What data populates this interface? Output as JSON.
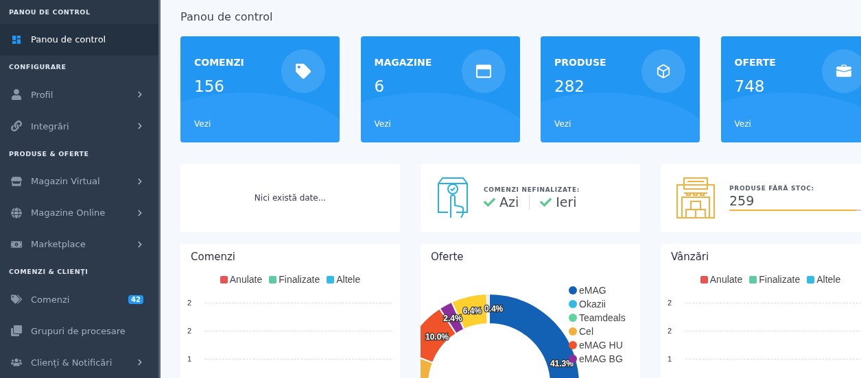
{
  "sidebar": {
    "sections": [
      {
        "heading": "PANOU DE CONTROL",
        "items": [
          {
            "label": "Panou de control",
            "selected": true,
            "has_submenu": false
          }
        ]
      },
      {
        "heading": "CONFIGURARE",
        "items": [
          {
            "label": "Profil",
            "selected": false,
            "has_submenu": true
          },
          {
            "label": "Integrări",
            "selected": false,
            "has_submenu": true
          }
        ]
      },
      {
        "heading": "PRODUSE & OFERTE",
        "items": [
          {
            "label": "Magazin Virtual",
            "selected": false,
            "has_submenu": true
          },
          {
            "label": "Magazine Online",
            "selected": false,
            "has_submenu": true
          },
          {
            "label": "Marketplace",
            "selected": false,
            "has_submenu": true
          }
        ]
      },
      {
        "heading": "COMENZI & CLIENŢI",
        "items": [
          {
            "label": "Comenzi",
            "selected": false,
            "has_submenu": false,
            "badge": "42"
          },
          {
            "label": "Grupuri de procesare",
            "selected": false,
            "has_submenu": false
          },
          {
            "label": "Clienți & Notificări",
            "selected": false,
            "has_submenu": true
          }
        ]
      }
    ]
  },
  "page_title": "Panou de control",
  "stat_cards": [
    {
      "title": "COMENZI",
      "value": "156",
      "link": "Vezi"
    },
    {
      "title": "MAGAZINE",
      "value": "6",
      "link": "Vezi"
    },
    {
      "title": "PRODUSE",
      "value": "282",
      "link": "Vezi"
    },
    {
      "title": "OFERTE",
      "value": "748",
      "link": "Vezi"
    }
  ],
  "info_cards": [
    {
      "kind": "empty",
      "message": "Nici există date..."
    },
    {
      "kind": "checks",
      "label": "COMENZI NEFINALIZATE:",
      "items": [
        {
          "label": "Azi",
          "checked": true
        },
        {
          "label": "Ieri",
          "checked": true
        }
      ]
    },
    {
      "kind": "stock",
      "label": "PRODUSE FĂRĂ STOC:",
      "value": "259",
      "level": 0.88
    }
  ],
  "chart_cards": [
    {
      "kind": "lines",
      "title": "Comenzi",
      "legend": [
        {
          "label": "Anulate",
          "color": "#e85353"
        },
        {
          "label": "Finalizate",
          "color": "#5fcba4"
        },
        {
          "label": "Altele",
          "color": "#33bbe6"
        }
      ],
      "y_labels": [
        "2",
        "2",
        "1"
      ]
    },
    {
      "kind": "donut",
      "title": "Oferte",
      "legend": [
        {
          "label": "eMAG",
          "color": "#1261b5"
        },
        {
          "label": "Okazii",
          "color": "#33bbe6"
        },
        {
          "label": "Teamdeals",
          "color": "#5dd39e"
        },
        {
          "label": "Cel",
          "color": "#f4b03c"
        },
        {
          "label": "eMAG HU",
          "color": "#f0522a"
        },
        {
          "label": "eMAG BG",
          "color": "#8e2e9a"
        }
      ],
      "chart_data": {
        "type": "donut",
        "series": [
          {
            "values": [
              41.3,
              39.5,
              10.0,
              2.4,
              6.4,
              0.4
            ]
          }
        ],
        "colors": [
          "#1261b5",
          "#f4b03c",
          "#f0522a",
          "#8e2e9a",
          "#fdd030",
          "#d4d0f5"
        ],
        "value_labels": [
          "41.3%",
          null,
          "10.0%",
          "2.4%",
          "6.4%",
          "0.4%"
        ]
      }
    },
    {
      "kind": "lines",
      "title": "Vânzări",
      "legend": [
        {
          "label": "Anulate",
          "color": "#e85353"
        },
        {
          "label": "Finalizate",
          "color": "#5fcba4"
        },
        {
          "label": "Altele",
          "color": "#33bbe6"
        }
      ],
      "y_labels": [
        "2",
        "2",
        "1"
      ]
    }
  ]
}
